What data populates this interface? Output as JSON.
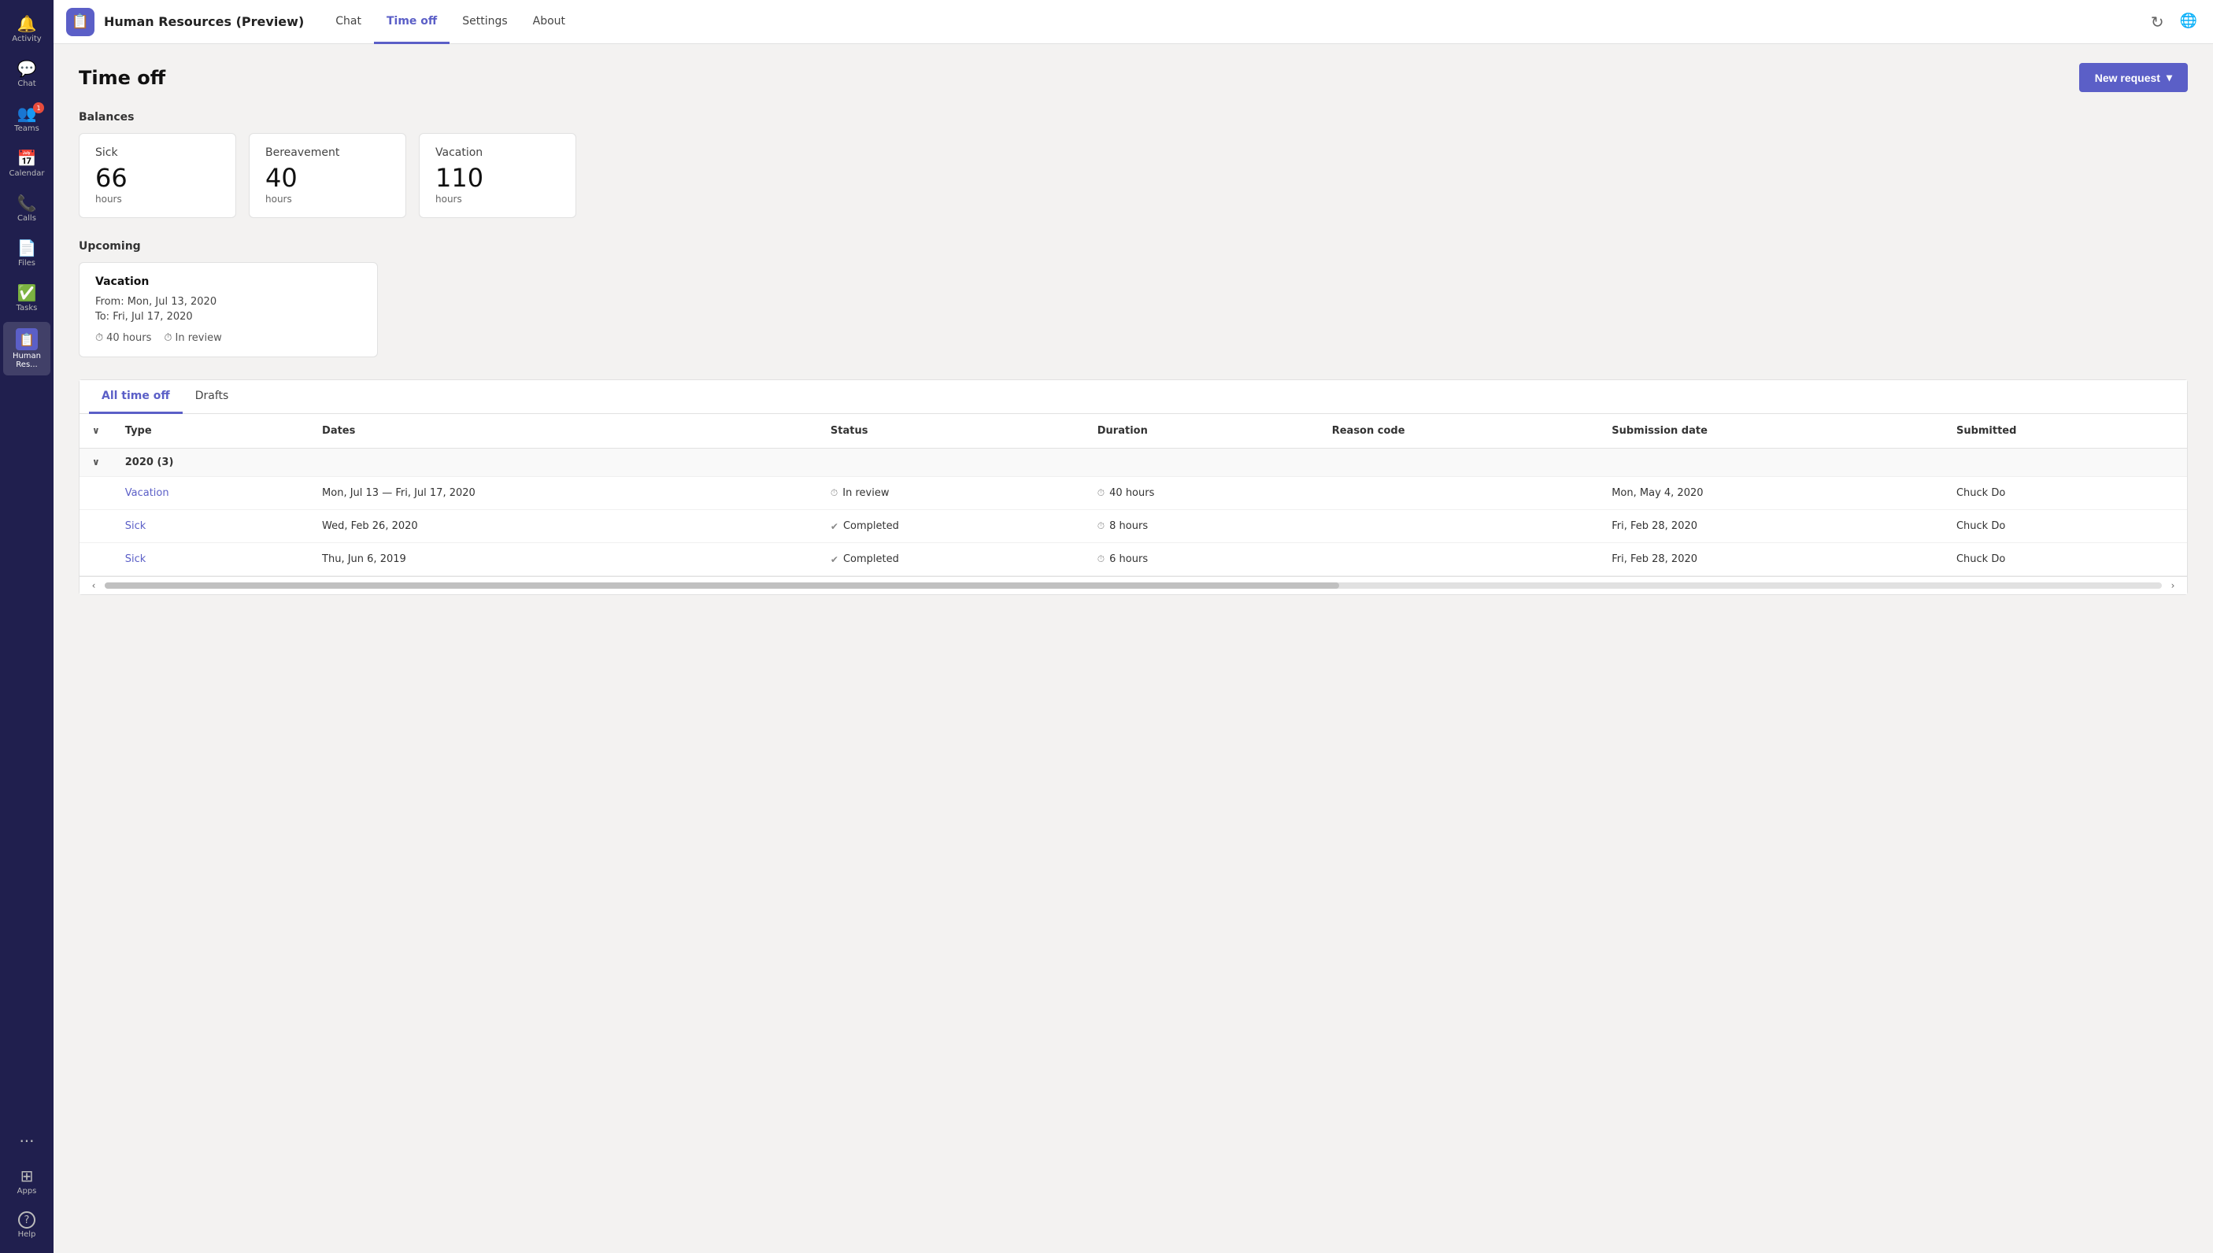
{
  "sidebar": {
    "items": [
      {
        "id": "activity",
        "label": "Activity",
        "icon": "🔔",
        "active": false,
        "badge": null
      },
      {
        "id": "chat",
        "label": "Chat",
        "icon": "💬",
        "active": false,
        "badge": null
      },
      {
        "id": "teams",
        "label": "Teams",
        "icon": "👥",
        "active": false,
        "badge": "1"
      },
      {
        "id": "calendar",
        "label": "Calendar",
        "icon": "📅",
        "active": false,
        "badge": null
      },
      {
        "id": "calls",
        "label": "Calls",
        "icon": "📞",
        "active": false,
        "badge": null
      },
      {
        "id": "files",
        "label": "Files",
        "icon": "📄",
        "active": false,
        "badge": null
      },
      {
        "id": "tasks",
        "label": "Tasks",
        "icon": "✅",
        "active": false,
        "badge": null
      },
      {
        "id": "humanres",
        "label": "Human Res...",
        "icon": "🏢",
        "active": true,
        "badge": null
      }
    ],
    "bottom_items": [
      {
        "id": "apps",
        "label": "Apps",
        "icon": "⊞"
      },
      {
        "id": "help",
        "label": "Help",
        "icon": "?"
      }
    ],
    "dots_label": "···"
  },
  "topbar": {
    "logo_icon": "📋",
    "app_title": "Human Resources (Preview)",
    "nav_items": [
      {
        "id": "chat",
        "label": "Chat",
        "active": false
      },
      {
        "id": "timeoff",
        "label": "Time off",
        "active": true
      },
      {
        "id": "settings",
        "label": "Settings",
        "active": false
      },
      {
        "id": "about",
        "label": "About",
        "active": false
      }
    ],
    "refresh_icon": "↻",
    "globe_icon": "🌐"
  },
  "page": {
    "title": "Time off",
    "new_request_label": "New request",
    "new_request_chevron": "▾"
  },
  "balances": {
    "section_title": "Balances",
    "cards": [
      {
        "id": "sick",
        "type": "Sick",
        "hours": "66",
        "label": "hours"
      },
      {
        "id": "bereavement",
        "type": "Bereavement",
        "hours": "40",
        "label": "hours"
      },
      {
        "id": "vacation",
        "type": "Vacation",
        "hours": "110",
        "label": "hours"
      }
    ]
  },
  "upcoming": {
    "section_title": "Upcoming",
    "card": {
      "title": "Vacation",
      "from": "From: Mon, Jul 13, 2020",
      "to": "To: Fri, Jul 17, 2020",
      "hours": "40 hours",
      "status": "In review",
      "hours_icon": "⏱",
      "status_icon": "⏱"
    }
  },
  "tabs": {
    "items": [
      {
        "id": "all-time-off",
        "label": "All time off",
        "active": true
      },
      {
        "id": "drafts",
        "label": "Drafts",
        "active": false
      }
    ]
  },
  "table": {
    "columns": [
      {
        "id": "expand",
        "label": ""
      },
      {
        "id": "type",
        "label": "Type"
      },
      {
        "id": "dates",
        "label": "Dates"
      },
      {
        "id": "status",
        "label": "Status"
      },
      {
        "id": "duration",
        "label": "Duration"
      },
      {
        "id": "reason-code",
        "label": "Reason code"
      },
      {
        "id": "submission-date",
        "label": "Submission date"
      },
      {
        "id": "submitted-by",
        "label": "Submitted"
      }
    ],
    "groups": [
      {
        "id": "2020",
        "label": "2020 (3)",
        "expanded": true,
        "rows": [
          {
            "type": "Vacation",
            "type_link": true,
            "dates": "Mon, Jul 13 — Fri, Jul 17, 2020",
            "status": "In review",
            "status_icon": "⏱",
            "duration": "40 hours",
            "duration_icon": "⏱",
            "reason_code": "",
            "submission_date": "Mon, May 4, 2020",
            "submitted_by": "Chuck Do"
          },
          {
            "type": "Sick",
            "type_link": true,
            "dates": "Wed, Feb 26, 2020",
            "status": "Completed",
            "status_icon": "✔",
            "duration": "8 hours",
            "duration_icon": "⏱",
            "reason_code": "",
            "submission_date": "Fri, Feb 28, 2020",
            "submitted_by": "Chuck Do"
          },
          {
            "type": "Sick",
            "type_link": true,
            "dates": "Thu, Jun 6, 2019",
            "status": "Completed",
            "status_icon": "✔",
            "duration": "6 hours",
            "duration_icon": "⏱",
            "reason_code": "",
            "submission_date": "Fri, Feb 28, 2020",
            "submitted_by": "Chuck Do"
          }
        ]
      }
    ]
  },
  "colors": {
    "brand": "#5b5fc7",
    "sidebar_bg": "#201f4e",
    "link": "#5b5fc7",
    "status_in_review": "#555",
    "status_completed": "#555"
  }
}
